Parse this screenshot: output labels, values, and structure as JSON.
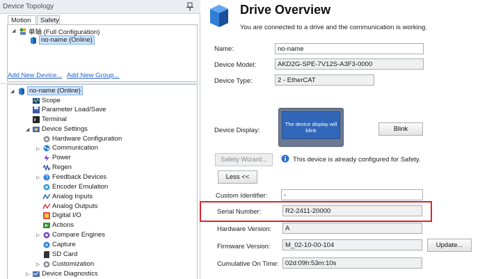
{
  "panel": {
    "title": "Device Topology"
  },
  "tabs": [
    {
      "label": "Motion"
    },
    {
      "label": "Safety"
    }
  ],
  "config": {
    "root_label": "单轴 (Full Configuration)",
    "device_label": "no-name (Online)",
    "add_device_link": "Add New Device...",
    "add_group_link": "Add New Group..."
  },
  "tree": {
    "root": "no-name (Online)",
    "scope": "Scope",
    "parameter_load_save": "Parameter Load/Save",
    "terminal": "Terminal",
    "device_settings": "Device Settings",
    "hardware_configuration": "Hardware Configuration",
    "communication": "Communication",
    "power": "Power",
    "regen": "Regen",
    "feedback_devices": "Feedback Devices",
    "encoder_emulation": "Encoder Emulation",
    "analog_inputs": "Analog Inputs",
    "analog_outputs": "Analog Outputs",
    "digital_io": "Digital I/O",
    "actions": "Actions",
    "compare_engines": "Compare Engines",
    "capture": "Capture",
    "sd_card": "SD Card",
    "customization": "Customization",
    "device_diagnostics": "Device Diagnostics"
  },
  "overview": {
    "title": "Drive Overview",
    "status": "You are connected to a drive and the communication is working."
  },
  "fields": {
    "name_label": "Name:",
    "name_value": "no-name",
    "model_label": "Device Model:",
    "model_value": "AKD2G-SPE-7V12S-A3F3-0000",
    "type_label": "Device Type:",
    "type_value": "2 - EtherCAT",
    "display_label": "Device Display:",
    "display_text": "The device display will blink",
    "blink_button": "Blink",
    "safety_wizard_button": "Safety Wizard...",
    "safety_note": "This device is already configured for Safety.",
    "less_button": "Less <<",
    "custom_id_label": "Custom Identifier:",
    "custom_id_value": "-",
    "serial_label": "Serial Number:",
    "serial_value": "R2-2411-20000",
    "hw_version_label": "Hardware Version:",
    "hw_version_value": "A",
    "fw_version_label": "Firmware Version:",
    "fw_version_value": "M_02-10-00-104",
    "update_button": "Update...",
    "on_time_label": "Cumulative On Time:",
    "on_time_value": "02d:09h:53m:10s"
  },
  "colors": {
    "selection": "#cfe3fb",
    "highlight": "#d9232a",
    "link": "#2a63c8",
    "display_screen": "#3166b8"
  }
}
